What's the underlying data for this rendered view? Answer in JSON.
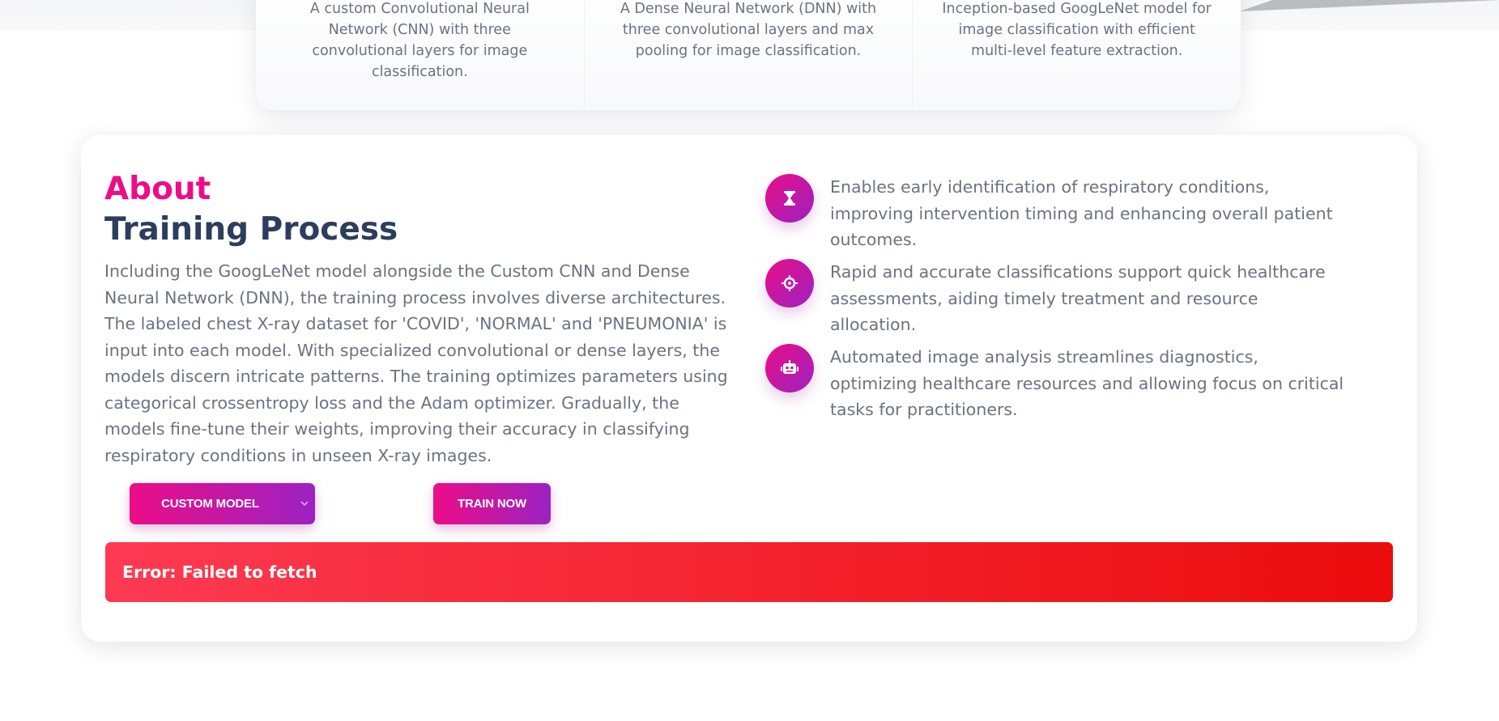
{
  "models": [
    {
      "description": "A custom Convolutional Neural Network (CNN) with three convolutional layers for image classification."
    },
    {
      "description": "A Dense Neural Network (DNN) with three convolutional layers and max pooling for image classification."
    },
    {
      "description": "Inception-based GoogLeNet model for image classification with efficient multi-level feature extraction."
    }
  ],
  "about": {
    "kicker": "About",
    "title": "Training Process",
    "text": "Including the GoogLeNet model alongside the Custom CNN and Dense Neural Network (DNN), the training process involves diverse architectures. The labeled chest X-ray dataset for 'COVID', 'NORMAL' and 'PNEUMONIA' is input into each model. With specialized convolutional or dense layers, the models discern intricate patterns. The training optimizes parameters using categorical crossentropy loss and the Adam optimizer. Gradually, the models fine-tune their weights, improving their accuracy in classifying respiratory conditions in unseen X-ray images."
  },
  "features": [
    {
      "icon": "hourglass-icon",
      "text": "Enables early identification of respiratory conditions, improving intervention timing and enhancing overall patient outcomes."
    },
    {
      "icon": "crosshair-icon",
      "text": "Rapid and accurate classifications support quick healthcare assessments, aiding timely treatment and resource allocation."
    },
    {
      "icon": "robot-icon",
      "text": "Automated image analysis streamlines diagnostics, optimizing healthcare resources and allowing focus on critical tasks for practitioners."
    }
  ],
  "controls": {
    "model_select_value": "CUSTOM MODEL",
    "train_label": "TRAIN NOW"
  },
  "error": {
    "message": "Error: Failed to fetch"
  },
  "colors": {
    "accent_pink": "#ec0d87",
    "accent_purple": "#9b22c2",
    "title_navy": "#2c3e5c",
    "body_gray": "#6b7280",
    "error_red": "#eb0c0c"
  }
}
